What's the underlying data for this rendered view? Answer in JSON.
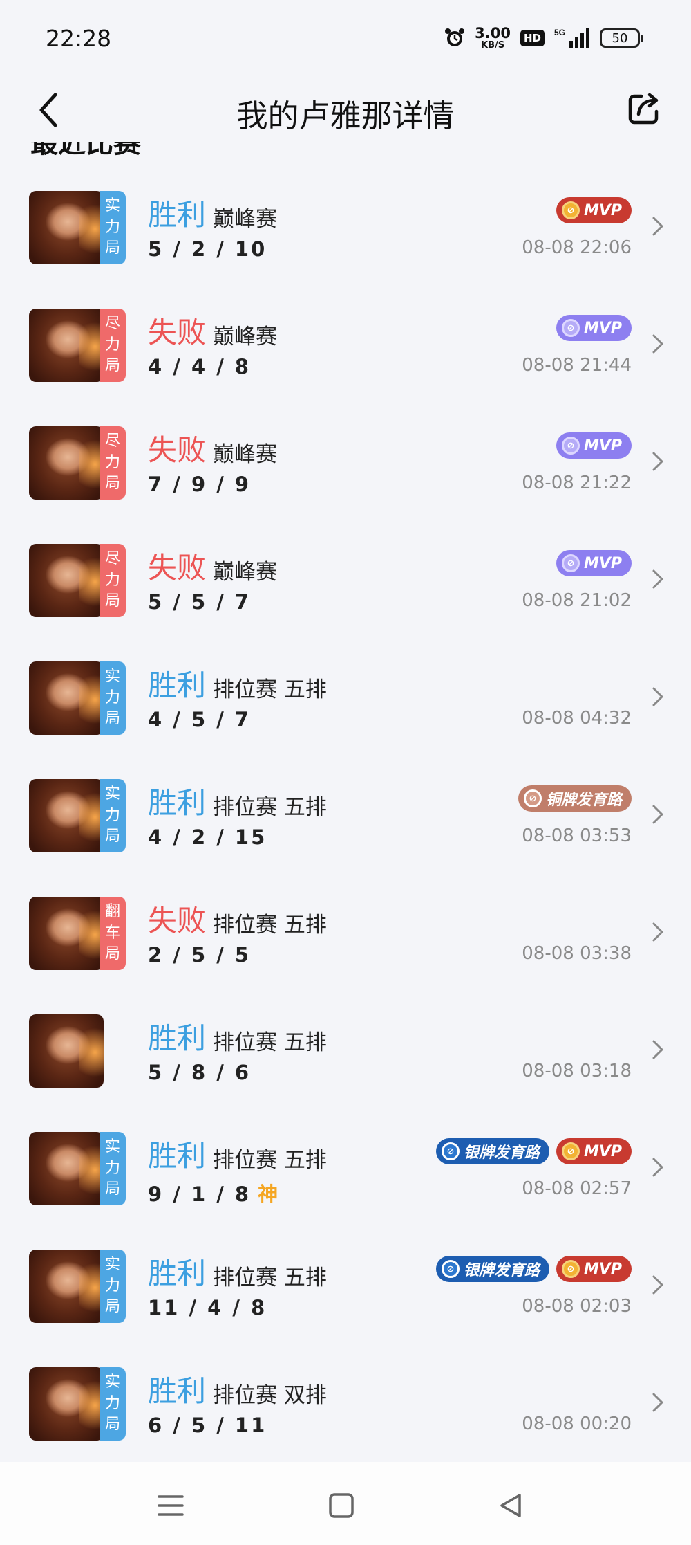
{
  "status_bar": {
    "time": "22:28",
    "net_speed_value": "3.00",
    "net_speed_unit": "KB/S",
    "hd_label": "HD",
    "network_label": "5G",
    "battery_level": "50"
  },
  "header": {
    "title": "我的卢雅那详情"
  },
  "section": {
    "title": "最近比赛"
  },
  "matches": [
    {
      "result": "胜利",
      "outcome": "win",
      "mode": "巅峰赛",
      "kda": "5 / 2 / 10",
      "time": "08-08 22:06",
      "tag": [
        "实",
        "力",
        "局"
      ],
      "tag_color": "blue",
      "badges": [
        "MVP"
      ],
      "badge_styles": [
        "mvp-gold"
      ]
    },
    {
      "result": "失败",
      "outcome": "loss",
      "mode": "巅峰赛",
      "kda": "4 / 4 / 8",
      "time": "08-08 21:44",
      "tag": [
        "尽",
        "力",
        "局"
      ],
      "tag_color": "red",
      "badges": [
        "MVP"
      ],
      "badge_styles": [
        "mvp-purple"
      ]
    },
    {
      "result": "失败",
      "outcome": "loss",
      "mode": "巅峰赛",
      "kda": "7 / 9 / 9",
      "time": "08-08 21:22",
      "tag": [
        "尽",
        "力",
        "局"
      ],
      "tag_color": "red",
      "badges": [
        "MVP"
      ],
      "badge_styles": [
        "mvp-purple"
      ]
    },
    {
      "result": "失败",
      "outcome": "loss",
      "mode": "巅峰赛",
      "kda": "5 / 5 / 7",
      "time": "08-08 21:02",
      "tag": [
        "尽",
        "力",
        "局"
      ],
      "tag_color": "red",
      "badges": [
        "MVP"
      ],
      "badge_styles": [
        "mvp-purple"
      ]
    },
    {
      "result": "胜利",
      "outcome": "win",
      "mode": "排位赛 五排",
      "kda": "4 / 5 / 7",
      "time": "08-08 04:32",
      "tag": [
        "实",
        "力",
        "局"
      ],
      "tag_color": "blue",
      "badges": [],
      "badge_styles": []
    },
    {
      "result": "胜利",
      "outcome": "win",
      "mode": "排位赛 五排",
      "kda": "4 / 2 / 15",
      "time": "08-08 03:53",
      "tag": [
        "实",
        "力",
        "局"
      ],
      "tag_color": "blue",
      "badges": [
        "铜牌发育路"
      ],
      "badge_styles": [
        "bronze-road"
      ]
    },
    {
      "result": "失败",
      "outcome": "loss",
      "mode": "排位赛 五排",
      "kda": "2 / 5 / 5",
      "time": "08-08 03:38",
      "tag": [
        "翻",
        "车",
        "局"
      ],
      "tag_color": "red",
      "badges": [],
      "badge_styles": []
    },
    {
      "result": "胜利",
      "outcome": "win",
      "mode": "排位赛 五排",
      "kda": "5 / 8 / 6",
      "time": "08-08 03:18",
      "tag": [],
      "tag_color": "",
      "badges": [],
      "badge_styles": []
    },
    {
      "result": "胜利",
      "outcome": "win",
      "mode": "排位赛 五排",
      "kda": "9 / 1 / 8",
      "extra": "神",
      "time": "08-08 02:57",
      "tag": [
        "实",
        "力",
        "局"
      ],
      "tag_color": "blue",
      "badges": [
        "银牌发育路",
        "MVP"
      ],
      "badge_styles": [
        "silver-road",
        "mvp-gold"
      ]
    },
    {
      "result": "胜利",
      "outcome": "win",
      "mode": "排位赛 五排",
      "kda": "11 / 4 / 8",
      "time": "08-08 02:03",
      "tag": [
        "实",
        "力",
        "局"
      ],
      "tag_color": "blue",
      "badges": [
        "银牌发育路",
        "MVP"
      ],
      "badge_styles": [
        "silver-road",
        "mvp-gold"
      ]
    },
    {
      "result": "胜利",
      "outcome": "win",
      "mode": "排位赛 双排",
      "kda": "6 / 5 / 11",
      "time": "08-08 00:20",
      "tag": [
        "实",
        "力",
        "局"
      ],
      "tag_color": "blue",
      "badges": [],
      "badge_styles": []
    }
  ],
  "colors": {
    "win": "#3c9fe0",
    "loss": "#ec5454",
    "background": "#f4f5f9"
  },
  "icons": {
    "back": "chevron-left-icon",
    "share": "share-icon",
    "row_arrow": "chevron-right-icon",
    "nav": [
      "menu-icon",
      "home-square-icon",
      "back-triangle-icon"
    ]
  }
}
